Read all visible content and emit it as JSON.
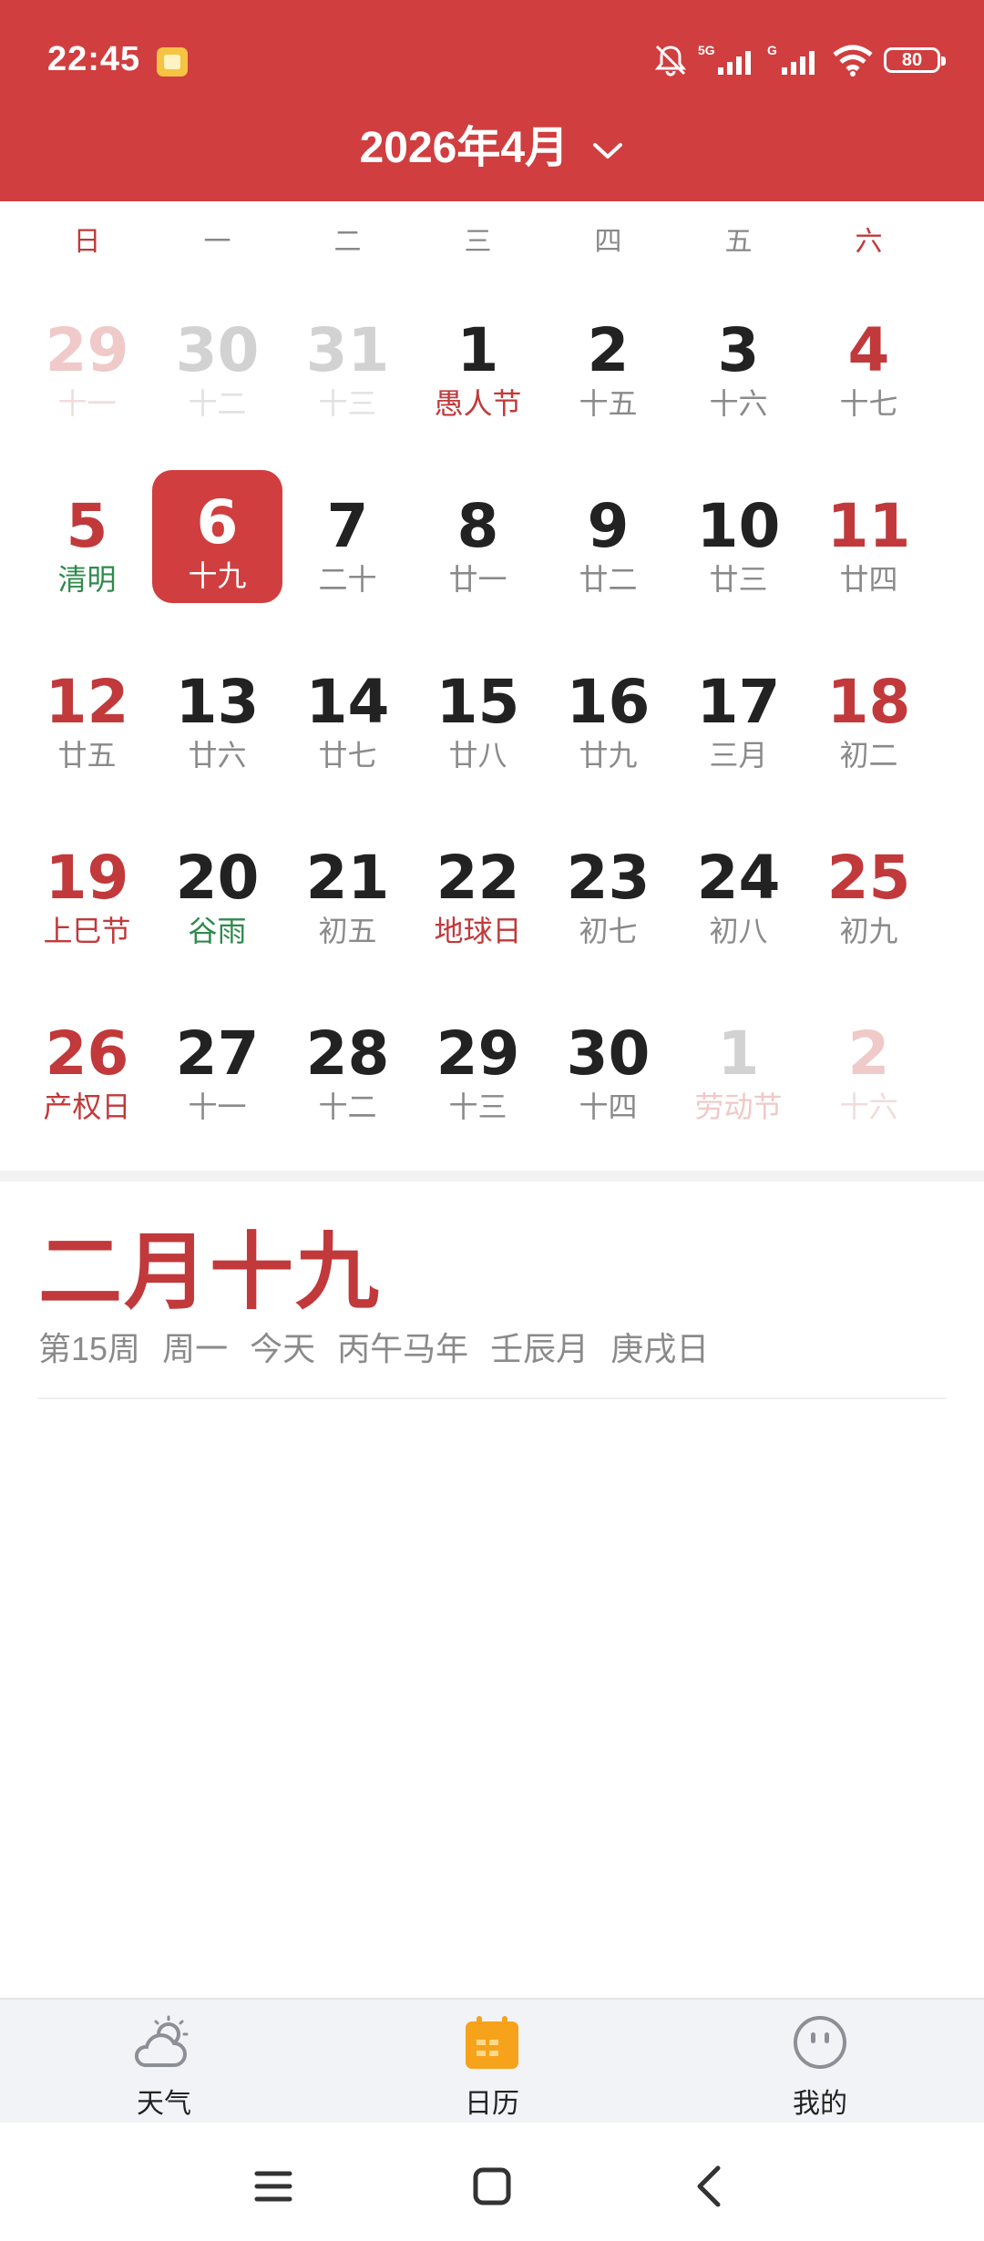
{
  "status_bar": {
    "time": "22:45",
    "battery": "80",
    "network1": "5G",
    "network2": "G"
  },
  "header": {
    "month_title": "2026年4月"
  },
  "weekdays": [
    "日",
    "一",
    "二",
    "三",
    "四",
    "五",
    "六"
  ],
  "weeks": [
    [
      {
        "num": "29",
        "sub": "十一",
        "faded": true,
        "weekend": true
      },
      {
        "num": "30",
        "sub": "十二",
        "faded": true
      },
      {
        "num": "31",
        "sub": "十三",
        "faded": true
      },
      {
        "num": "1",
        "sub": "愚人节",
        "sub_type": "hol"
      },
      {
        "num": "2",
        "sub": "十五"
      },
      {
        "num": "3",
        "sub": "十六"
      },
      {
        "num": "4",
        "sub": "十七",
        "weekend": true
      }
    ],
    [
      {
        "num": "5",
        "sub": "清明",
        "sub_type": "term",
        "weekend": true
      },
      {
        "num": "6",
        "sub": "十九",
        "selected": true
      },
      {
        "num": "7",
        "sub": "二十"
      },
      {
        "num": "8",
        "sub": "廿一"
      },
      {
        "num": "9",
        "sub": "廿二"
      },
      {
        "num": "10",
        "sub": "廿三"
      },
      {
        "num": "11",
        "sub": "廿四",
        "weekend": true
      }
    ],
    [
      {
        "num": "12",
        "sub": "廿五",
        "weekend": true
      },
      {
        "num": "13",
        "sub": "廿六"
      },
      {
        "num": "14",
        "sub": "廿七"
      },
      {
        "num": "15",
        "sub": "廿八"
      },
      {
        "num": "16",
        "sub": "廿九"
      },
      {
        "num": "17",
        "sub": "三月"
      },
      {
        "num": "18",
        "sub": "初二",
        "weekend": true
      }
    ],
    [
      {
        "num": "19",
        "sub": "上巳节",
        "sub_type": "hol",
        "weekend": true
      },
      {
        "num": "20",
        "sub": "谷雨",
        "sub_type": "term"
      },
      {
        "num": "21",
        "sub": "初五"
      },
      {
        "num": "22",
        "sub": "地球日",
        "sub_type": "hol"
      },
      {
        "num": "23",
        "sub": "初七"
      },
      {
        "num": "24",
        "sub": "初八"
      },
      {
        "num": "25",
        "sub": "初九",
        "weekend": true
      }
    ],
    [
      {
        "num": "26",
        "sub": "产权日",
        "sub_type": "hol",
        "weekend": true
      },
      {
        "num": "27",
        "sub": "十一"
      },
      {
        "num": "28",
        "sub": "十二"
      },
      {
        "num": "29",
        "sub": "十三"
      },
      {
        "num": "30",
        "sub": "十四"
      },
      {
        "num": "1",
        "sub": "劳动节",
        "sub_type": "hol",
        "faded": true
      },
      {
        "num": "2",
        "sub": "十六",
        "faded": true,
        "weekend": true
      }
    ]
  ],
  "detail": {
    "lunar_date": "二月十九",
    "info": [
      "第15周",
      "周一",
      "今天",
      "丙午马年",
      "壬辰月",
      "庚戌日"
    ]
  },
  "tabs": [
    {
      "label": "天气",
      "icon": "weather-icon"
    },
    {
      "label": "日历",
      "icon": "calendar-icon"
    },
    {
      "label": "我的",
      "icon": "profile-icon"
    }
  ],
  "colors": {
    "accent": "#d03e3f",
    "weekend": "#c1393b",
    "solar_term": "#2f8a4c",
    "tab_active": "#f7a21b"
  }
}
